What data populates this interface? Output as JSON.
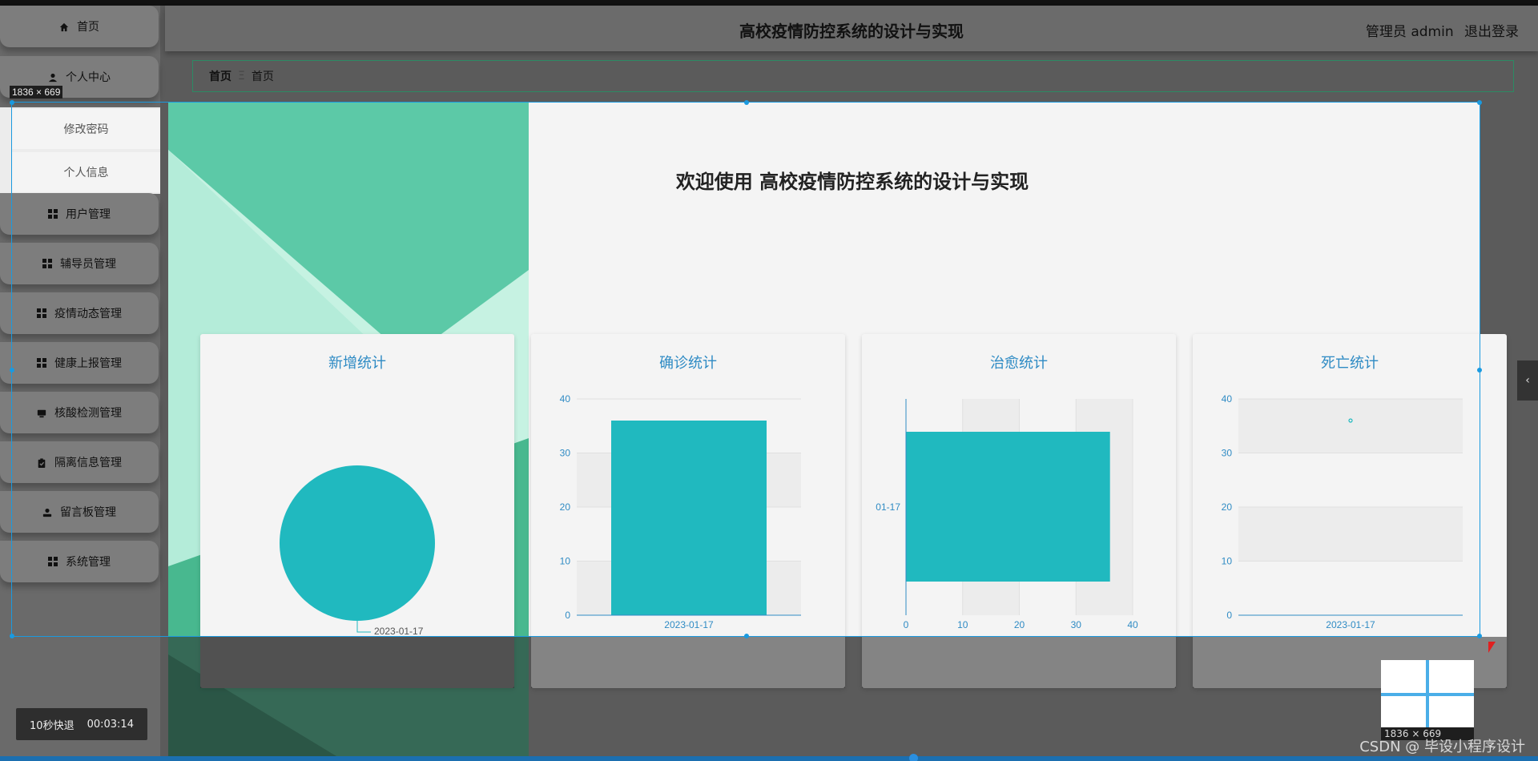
{
  "header": {
    "title": "高校疫情防控系统的设计与实现",
    "user": "管理员 admin",
    "logout": "退出登录"
  },
  "sidebar": {
    "items": [
      {
        "label": "首页",
        "icon": "home-icon"
      },
      {
        "label": "个人中心",
        "icon": "user-icon"
      },
      {
        "label": "用户管理",
        "icon": "grid-icon"
      },
      {
        "label": "辅导员管理",
        "icon": "grid-icon"
      },
      {
        "label": "疫情动态管理",
        "icon": "grid-icon"
      },
      {
        "label": "健康上报管理",
        "icon": "grid-icon"
      },
      {
        "label": "核酸检测管理",
        "icon": "monitor-icon"
      },
      {
        "label": "隔离信息管理",
        "icon": "clipboard-icon"
      },
      {
        "label": "留言板管理",
        "icon": "person-icon"
      },
      {
        "label": "系统管理",
        "icon": "grid-icon"
      }
    ],
    "submenu": [
      "修改密码",
      "个人信息"
    ]
  },
  "breadcrumb": {
    "root": "首页",
    "separator": "Ξ",
    "current": "首页"
  },
  "welcome": "欢迎使用 高校疫情防控系统的设计与实现",
  "selection_label": "1836 × 669",
  "timer": {
    "label": "10秒快退",
    "time": "00:03:14"
  },
  "watermark": "CSDN @ 毕设小程序设计",
  "thumb_label": "1836 × 669",
  "accent_color": "#20b9bf",
  "title_color": "#2f8bc4",
  "chart_data": [
    {
      "type": "pie",
      "title": "新增统计",
      "categories": [
        "2023-01-17"
      ],
      "values": [
        1
      ]
    },
    {
      "type": "bar",
      "title": "确诊统计",
      "categories": [
        "2023-01-17"
      ],
      "values": [
        36
      ],
      "ylim": [
        0,
        40
      ],
      "yticks": [
        "0",
        "10",
        "20",
        "30",
        "40"
      ]
    },
    {
      "type": "bar",
      "orientation": "horizontal",
      "title": "治愈统计",
      "categories": [
        "2023-01-17"
      ],
      "category_label_visible": "01-17",
      "values": [
        36
      ],
      "xlim": [
        0,
        40
      ],
      "xticks": [
        "0",
        "10",
        "20",
        "30",
        "40"
      ]
    },
    {
      "type": "scatter",
      "title": "死亡统计",
      "categories": [
        "2023-01-17"
      ],
      "values": [
        36
      ],
      "ylim": [
        0,
        40
      ],
      "yticks": [
        "0",
        "10",
        "20",
        "30",
        "40"
      ]
    }
  ]
}
